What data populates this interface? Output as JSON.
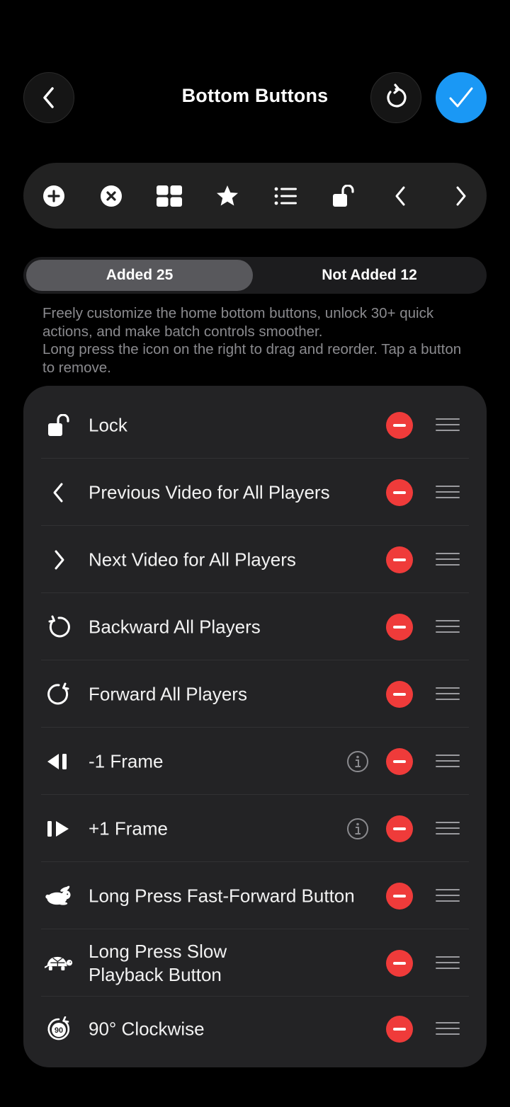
{
  "header": {
    "title": "Bottom Buttons"
  },
  "toolbar": {
    "icons": [
      "add-circle-icon",
      "close-circle-icon",
      "grid-icon",
      "star-icon",
      "list-icon",
      "unlock-icon",
      "chevron-left-icon",
      "chevron-right-icon"
    ]
  },
  "segments": {
    "added_label": "Added 25",
    "not_added_label": "Not Added 12",
    "selected": "added"
  },
  "description": {
    "line1": "Freely customize the home bottom buttons, unlock 30+ quick actions, and make batch controls smoother.",
    "line2": "Long press the icon on the right to drag and reorder. Tap a button to remove."
  },
  "items": [
    {
      "label": "Lock",
      "icon": "unlock-icon",
      "info": false
    },
    {
      "label": "Previous Video for All Players",
      "icon": "chevron-left-icon",
      "info": false
    },
    {
      "label": "Next Video for All Players",
      "icon": "chevron-right-icon",
      "info": false
    },
    {
      "label": "Backward All Players",
      "icon": "rotate-ccw-icon",
      "info": false
    },
    {
      "label": "Forward All Players",
      "icon": "rotate-cw-icon",
      "info": false
    },
    {
      "label": "-1 Frame",
      "icon": "frame-back-icon",
      "info": true
    },
    {
      "label": "+1 Frame",
      "icon": "frame-forward-icon",
      "info": true
    },
    {
      "label": "Long Press Fast-Forward Button",
      "icon": "rabbit-icon",
      "info": false
    },
    {
      "label": "Long Press Slow Playback Button",
      "icon": "turtle-icon",
      "info": false
    },
    {
      "label": "90° Clockwise",
      "icon": "rotate-90-icon",
      "info": false
    }
  ],
  "colors": {
    "accent": "#1a98f5",
    "remove": "#ef3b3a",
    "background": "#000000",
    "card": "#232325"
  }
}
